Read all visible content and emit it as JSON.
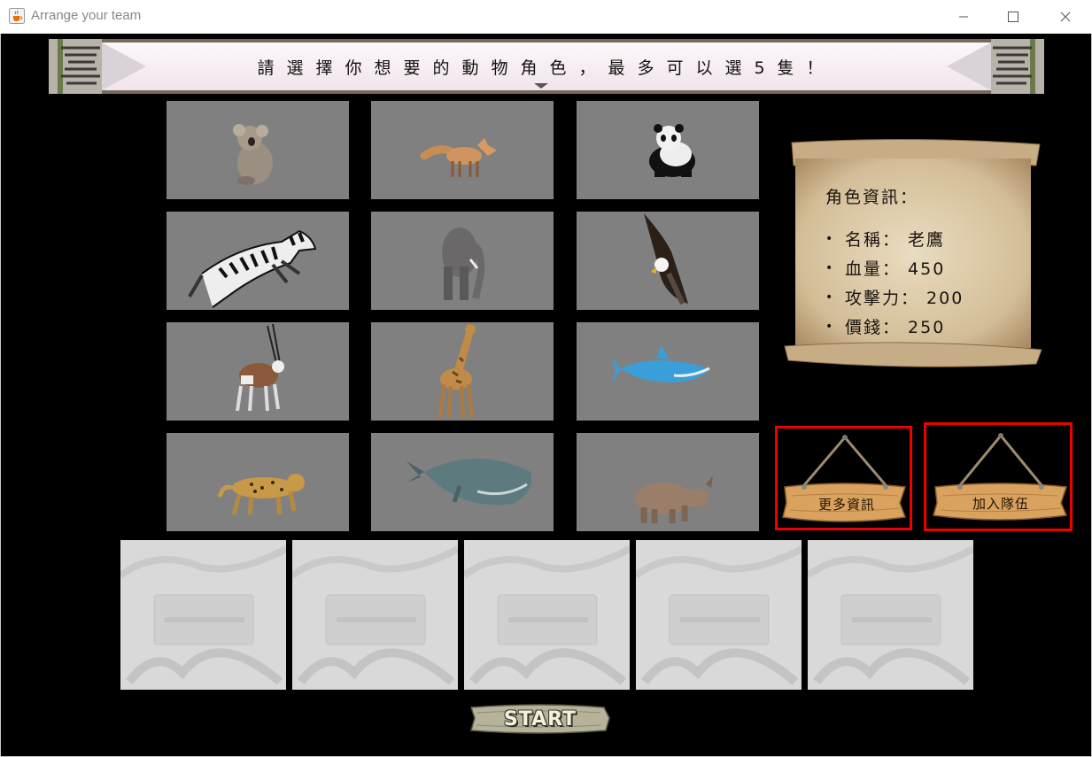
{
  "window": {
    "title": "Arrange your team",
    "icon": "java-cup-icon"
  },
  "banner": {
    "text": "請選擇你想要的動物角色，最多可以選5隻！"
  },
  "animals": [
    {
      "name": "koala",
      "icon": "koala-icon"
    },
    {
      "name": "fox",
      "icon": "fox-icon"
    },
    {
      "name": "panda",
      "icon": "panda-icon"
    },
    {
      "name": "zebra",
      "icon": "zebra-icon"
    },
    {
      "name": "elephant",
      "icon": "elephant-icon"
    },
    {
      "name": "eagle",
      "icon": "eagle-icon"
    },
    {
      "name": "oryx",
      "icon": "oryx-icon"
    },
    {
      "name": "giraffe",
      "icon": "giraffe-icon"
    },
    {
      "name": "shark",
      "icon": "shark-icon"
    },
    {
      "name": "leopard",
      "icon": "leopard-icon"
    },
    {
      "name": "sperm-whale",
      "icon": "whale-icon"
    },
    {
      "name": "rhinoceros",
      "icon": "rhino-icon"
    }
  ],
  "info": {
    "title": "角色資訊：",
    "rows": [
      {
        "bullet": "•",
        "text": "名稱： 老鷹"
      },
      {
        "bullet": "•",
        "text": "血量： 450"
      },
      {
        "bullet": "•",
        "text": "攻擊力： 200"
      },
      {
        "bullet": "•",
        "text": "價錢： 250"
      }
    ]
  },
  "buttons": {
    "more_info": "更多資訊",
    "join_team": "加入隊伍",
    "start": "START"
  },
  "team_slots": 5,
  "colors": {
    "background": "#000000",
    "tile": "#808080",
    "highlight_border": "#ee0000",
    "parchment": "#d8c4a0",
    "wood": "#d9a25e",
    "slot": "#d9d9d9"
  }
}
